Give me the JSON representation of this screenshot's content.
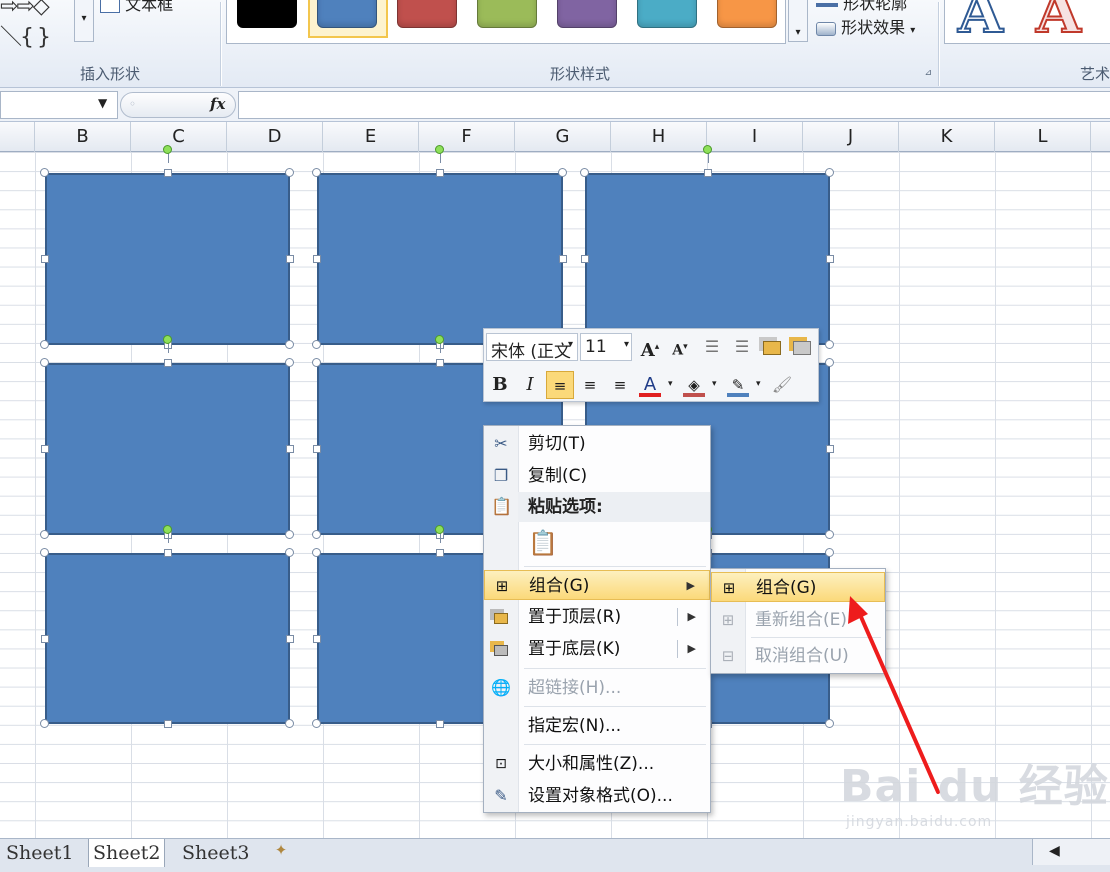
{
  "ribbon": {
    "insert_shapes_label": "插入形状",
    "text_box_label": "文本框",
    "shape_styles_label": "形状样式",
    "shape_outline_label": "形状轮廓",
    "shape_effects_label": "形状效果",
    "wordart_label": "艺术",
    "wordart_glyph": "A",
    "swatches": [
      "#000000",
      "#4f81bd",
      "#c0504d",
      "#9bbb59",
      "#8064a2",
      "#4bacc6",
      "#f79646"
    ]
  },
  "formula_bar": {
    "fx_label": "fx",
    "name_value": "",
    "formula_value": ""
  },
  "columns": [
    "B",
    "C",
    "D",
    "E",
    "F",
    "G",
    "H",
    "I",
    "J",
    "K",
    "L"
  ],
  "mini_toolbar": {
    "font_name": "宋体 (正文",
    "font_size": "11",
    "bold": "B",
    "italic": "I",
    "font_color_glyph": "A"
  },
  "context_menu": {
    "items": [
      {
        "label": "剪切(T)",
        "icon": "scissors-icon",
        "enabled": true
      },
      {
        "label": "复制(C)",
        "icon": "copy-icon",
        "enabled": true
      },
      {
        "label": "粘贴选项:",
        "icon": "paste-icon",
        "enabled": true
      },
      {
        "label": "组合(G)",
        "icon": "group-icon",
        "enabled": true,
        "submenu": true
      },
      {
        "label": "置于顶层(R)",
        "icon": "bring-to-front-icon",
        "enabled": true,
        "submenu": true
      },
      {
        "label": "置于底层(K)",
        "icon": "send-to-back-icon",
        "enabled": true,
        "submenu": true
      },
      {
        "label": "超链接(H)...",
        "icon": "hyperlink-icon",
        "enabled": false
      },
      {
        "label": "指定宏(N)...",
        "icon": "",
        "enabled": true
      },
      {
        "label": "大小和属性(Z)...",
        "icon": "size-properties-icon",
        "enabled": true
      },
      {
        "label": "设置对象格式(O)...",
        "icon": "format-object-icon",
        "enabled": true
      }
    ]
  },
  "submenu": {
    "items": [
      {
        "label": "组合(G)",
        "icon": "group-icon",
        "enabled": true
      },
      {
        "label": "重新组合(E)",
        "icon": "regroup-icon",
        "enabled": false
      },
      {
        "label": "取消组合(U)",
        "icon": "ungroup-icon",
        "enabled": false
      }
    ]
  },
  "sheet_tabs": [
    "Sheet1",
    "Sheet2",
    "Sheet3"
  ],
  "watermark": {
    "main": "Bai du 经验",
    "sub": "jingyan.baidu.com"
  }
}
